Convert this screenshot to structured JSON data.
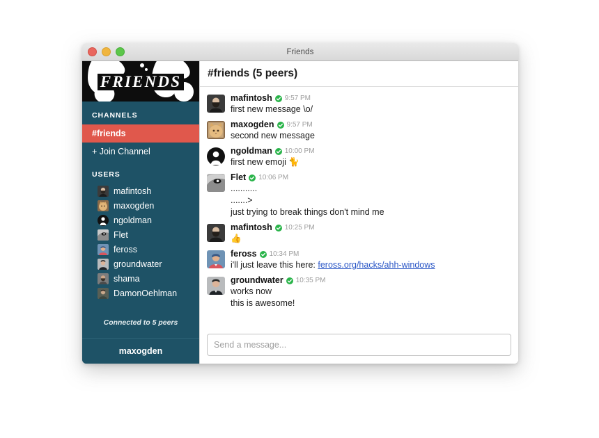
{
  "window": {
    "title": "Friends",
    "traffic_lights": [
      "close",
      "minimize",
      "maximize"
    ]
  },
  "sidebar": {
    "logo_text": "FRIENDS",
    "channels_heading": "CHANNELS",
    "channels": [
      {
        "label": "#friends",
        "active": true
      },
      {
        "label": "+ Join Channel",
        "active": false
      }
    ],
    "users_heading": "USERS",
    "users": [
      {
        "name": "mafintosh"
      },
      {
        "name": "maxogden"
      },
      {
        "name": "ngoldman"
      },
      {
        "name": "Flet"
      },
      {
        "name": "feross"
      },
      {
        "name": "groundwater"
      },
      {
        "name": "shama"
      },
      {
        "name": "DamonOehlman"
      }
    ],
    "peers_status": "Connected to 5 peers",
    "current_user": "maxogden"
  },
  "main": {
    "channel_title": "#friends (5 peers)",
    "messages": [
      {
        "author": "mafintosh",
        "verified": true,
        "time": "9:57 PM",
        "avatar": "mafintosh",
        "lines": [
          "first new message \\o/"
        ]
      },
      {
        "author": "maxogden",
        "verified": true,
        "time": "9:57 PM",
        "avatar": "maxogden",
        "lines": [
          "second new message"
        ]
      },
      {
        "author": "ngoldman",
        "verified": true,
        "time": "10:00 PM",
        "avatar": "ngoldman",
        "lines": [
          "first new emoji 🐈"
        ]
      },
      {
        "author": "Flet",
        "verified": true,
        "time": "10:06 PM",
        "avatar": "flet",
        "lines": [
          "...........",
          ".......>",
          "just trying to break things don't mind me"
        ]
      },
      {
        "author": "mafintosh",
        "verified": true,
        "time": "10:25 PM",
        "avatar": "mafintosh",
        "lines": [
          "👍"
        ]
      },
      {
        "author": "feross",
        "verified": true,
        "time": "10:34 PM",
        "avatar": "feross",
        "lines": [
          "i'll just leave this here: "
        ],
        "link_text": "feross.org/hacks/ahh-windows"
      },
      {
        "author": "groundwater",
        "verified": true,
        "time": "10:35 PM",
        "avatar": "groundwater",
        "lines": [
          "works now",
          "this is awesome!"
        ]
      }
    ],
    "composer_placeholder": "Send a message..."
  },
  "colors": {
    "sidebar_teal": "#1e5266",
    "active_channel_red": "#e0584c",
    "logo_black": "#0d0d0d",
    "verified_green": "#2ab44a",
    "link_blue": "#2a56c6",
    "window_chrome": "#e0e0e0"
  },
  "icons": {
    "verified": "verified-badge-icon",
    "close": "close-traffic-light-icon",
    "minimize": "minimize-traffic-light-icon",
    "maximize": "maximize-traffic-light-icon"
  }
}
